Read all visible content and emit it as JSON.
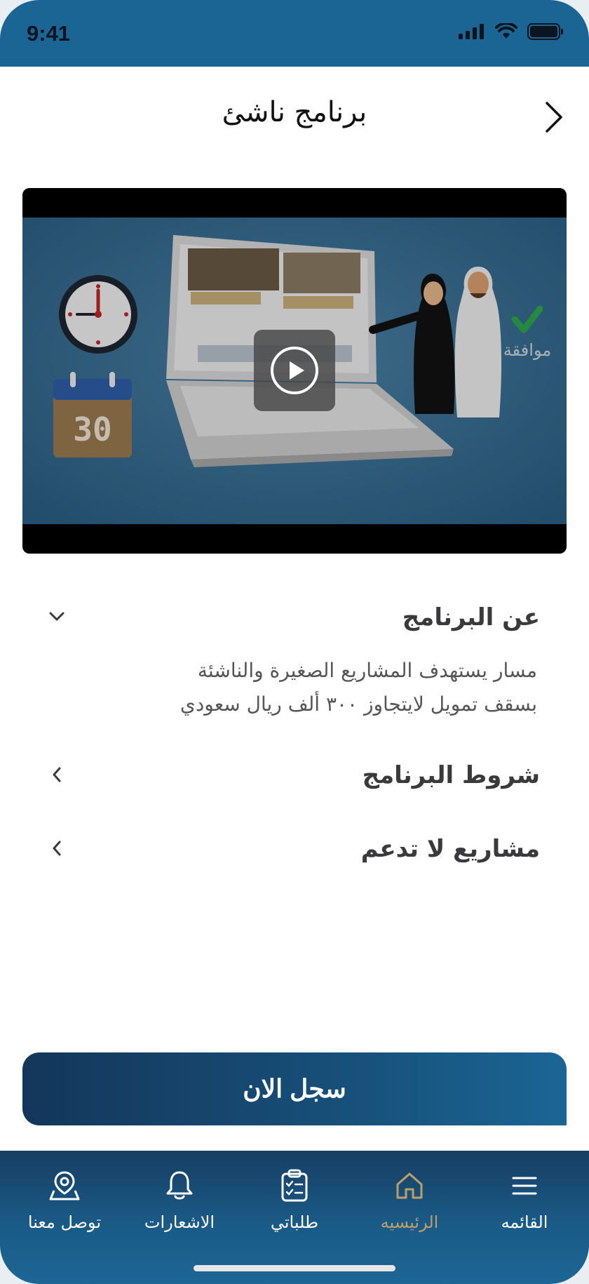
{
  "status_bar": {
    "time": "9:41"
  },
  "header": {
    "title": "برنامج ناشئ"
  },
  "video": {
    "overlay_caption": "موافقة",
    "calendar_day": "30"
  },
  "accordion": [
    {
      "title": "عن البرنامج",
      "expanded": true,
      "body_line1": "مسار يستهدف المشاريع الصغيرة والناشئة",
      "body_line2": "بسقف تمويل لايتجاوز ٣٠٠ ألف ريال سعودي"
    },
    {
      "title": "شروط البرنامج",
      "expanded": false
    },
    {
      "title": "مشاريع لا تدعم",
      "expanded": false
    }
  ],
  "register_button": {
    "label": "سجل الان"
  },
  "tabs": [
    {
      "label": "توصل معنا",
      "icon": "location-map-icon",
      "active": false
    },
    {
      "label": "الاشعارات",
      "icon": "bell-icon",
      "active": false
    },
    {
      "label": "طلباتي",
      "icon": "clipboard-icon",
      "active": false
    },
    {
      "label": "الرئيسيه",
      "icon": "home-icon",
      "active": true
    },
    {
      "label": "القائمه",
      "icon": "menu-icon",
      "active": false
    }
  ],
  "colors": {
    "brand_dark": "#14365a",
    "brand": "#1b6595",
    "active_tab": "#b9a06b"
  }
}
